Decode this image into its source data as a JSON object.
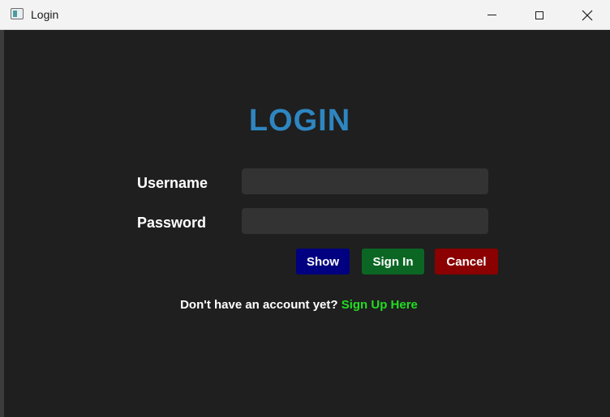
{
  "window": {
    "title": "Login",
    "icons": {
      "app": "app-window-icon",
      "minimize": "minimize-icon",
      "maximize": "maximize-icon",
      "close": "close-icon"
    }
  },
  "form": {
    "heading": "LOGIN",
    "username_label": "Username",
    "username_value": "",
    "password_label": "Password",
    "password_value": ""
  },
  "buttons": {
    "show_label": "Show",
    "signin_label": "Sign In",
    "cancel_label": "Cancel"
  },
  "footer": {
    "prompt": "Don't have an account yet?",
    "link": "Sign Up Here"
  },
  "colors": {
    "background": "#1f1f1f",
    "heading": "#2e86c1",
    "input_bg": "#333333",
    "show_button": "#000080",
    "signin_button": "#0b6623",
    "cancel_button": "#8b0000",
    "signup_link": "#22dd22"
  }
}
